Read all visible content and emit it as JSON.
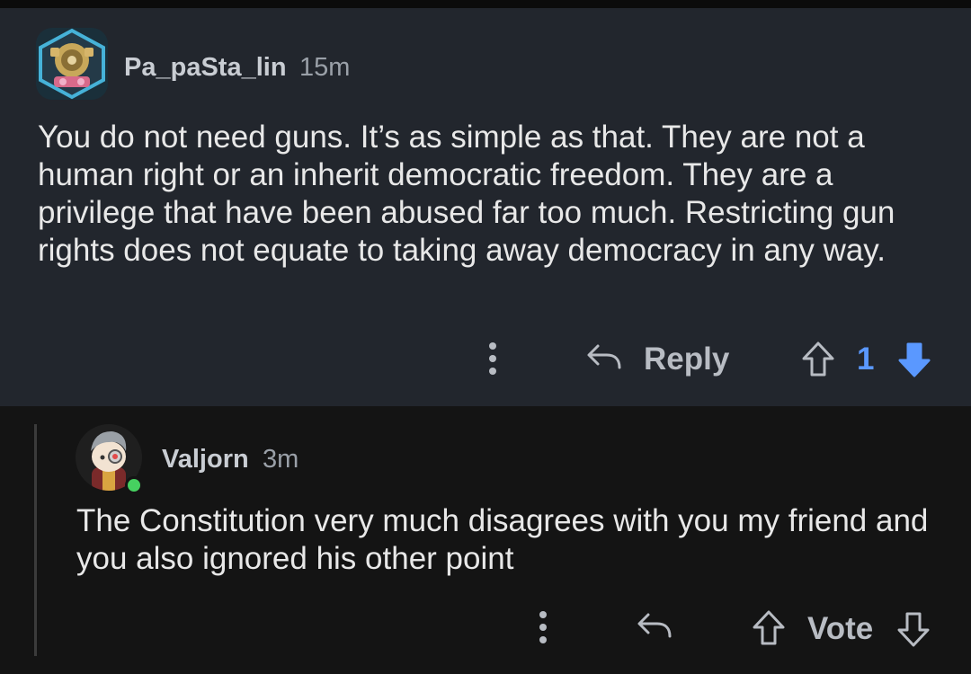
{
  "parent_comment": {
    "username": "Pa_paSta_lin",
    "timestamp": "15m",
    "body": "You do not need guns. It’s as simple as that. They are not a human right or an inherit democratic freedom. They are a privilege that have been abused far too much. Restricting gun rights does not equate to taking away democracy in any way.",
    "reply_label": "Reply",
    "vote_count": "1",
    "vote_color": "#5a98ff"
  },
  "reply_comment": {
    "username": "Valjorn",
    "timestamp": "3m",
    "body": "The Constitution very much disagrees with you my friend and you also ignored his other point",
    "vote_label": "Vote",
    "online_color": "#46d160"
  }
}
